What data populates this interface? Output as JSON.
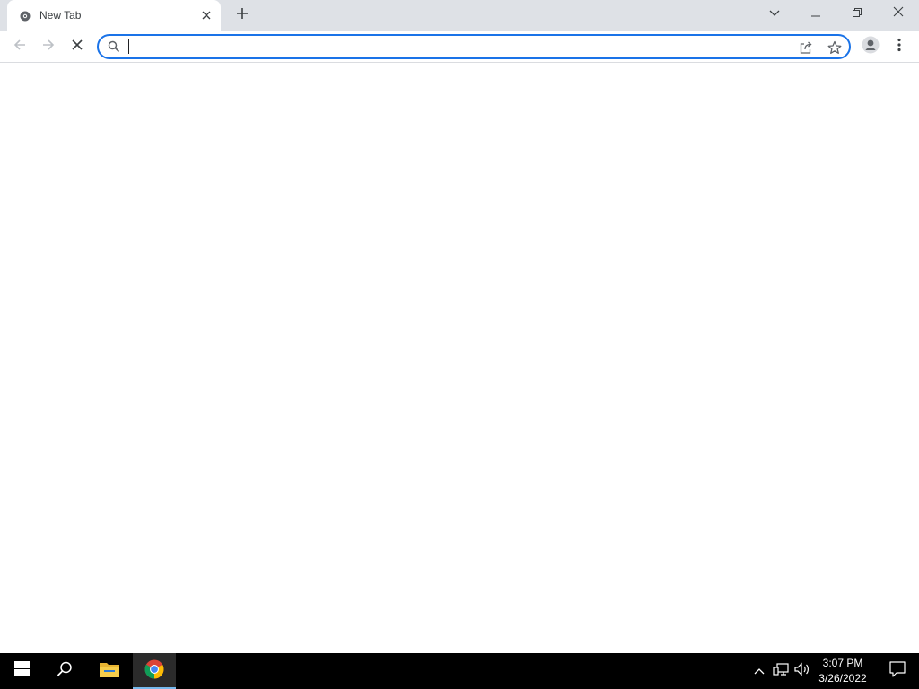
{
  "browser": {
    "tab": {
      "title": "New Tab",
      "favicon": "chrome-newtab-icon",
      "close_icon": "close-icon"
    },
    "new_tab_icon": "plus-icon",
    "window_controls": {
      "tab_search_icon": "chevron-down-icon",
      "minimize_icon": "minimize-icon",
      "restore_icon": "restore-icon",
      "close_icon": "close-icon"
    },
    "toolbar": {
      "back_icon": "arrow-left-icon",
      "forward_icon": "arrow-right-icon",
      "stop_icon": "stop-loading-icon",
      "profile_icon": "profile-icon",
      "menu_icon": "kebab-menu-icon"
    },
    "omnibox": {
      "value": "",
      "placeholder": "",
      "search_icon": "search-icon",
      "share_icon": "share-icon",
      "bookmark_icon": "star-icon"
    }
  },
  "taskbar": {
    "start_icon": "windows-start-icon",
    "search_icon": "search-icon",
    "apps": [
      {
        "name": "File Explorer",
        "icon": "folder-icon",
        "active": false
      },
      {
        "name": "Google Chrome",
        "icon": "chrome-icon",
        "active": true
      }
    ],
    "tray": {
      "overflow_icon": "chevron-up-icon",
      "network_icon": "network-icon",
      "volume_icon": "volume-icon"
    },
    "clock": {
      "time": "3:07 PM",
      "date": "3/26/2022"
    },
    "notification_icon": "action-center-icon"
  },
  "colors": {
    "tabstrip_bg": "#dee1e6",
    "omnibox_focus": "#1a73e8",
    "taskbar_bg": "#000000",
    "taskbar_active_indicator": "#76b9ed"
  }
}
